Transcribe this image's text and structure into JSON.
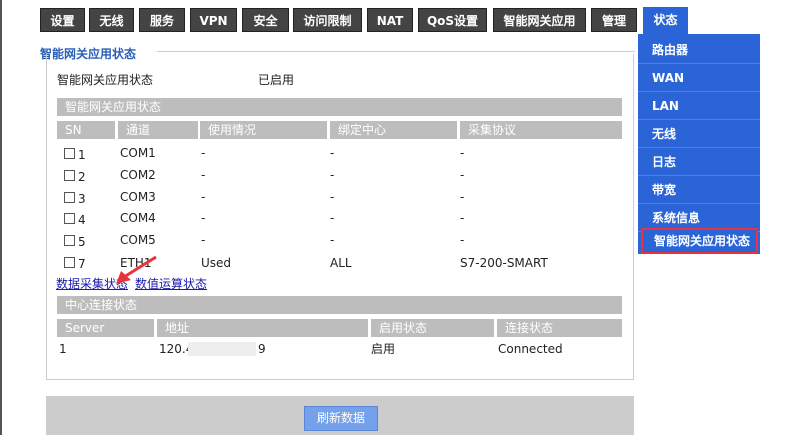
{
  "nav": {
    "tabs": [
      {
        "label": "设置"
      },
      {
        "label": "无线"
      },
      {
        "label": "服务"
      },
      {
        "label": "VPN"
      },
      {
        "label": "安全"
      },
      {
        "label": "访问限制"
      },
      {
        "label": "NAT"
      },
      {
        "label": "QoS设置"
      },
      {
        "label": "智能网关应用"
      },
      {
        "label": "管理"
      },
      {
        "label": "状态"
      }
    ],
    "active_tab": "状态"
  },
  "page": {
    "section_title": "智能网关应用状态",
    "status_label": "智能网关应用状态",
    "status_value": "已启用",
    "table_title": "智能网关应用状态",
    "columns": [
      "SN",
      "通道",
      "使用情况",
      "绑定中心",
      "采集协议"
    ],
    "rows": [
      {
        "sn": "1",
        "channel": "COM1",
        "usage": "-",
        "center": "-",
        "protocol": "-",
        "checked": false
      },
      {
        "sn": "2",
        "channel": "COM2",
        "usage": "-",
        "center": "-",
        "protocol": "-",
        "checked": false
      },
      {
        "sn": "3",
        "channel": "COM3",
        "usage": "-",
        "center": "-",
        "protocol": "-",
        "checked": false
      },
      {
        "sn": "4",
        "channel": "COM4",
        "usage": "-",
        "center": "-",
        "protocol": "-",
        "checked": false
      },
      {
        "sn": "5",
        "channel": "COM5",
        "usage": "-",
        "center": "-",
        "protocol": "-",
        "checked": false
      },
      {
        "sn": "7",
        "channel": "ETH1",
        "usage": "Used",
        "center": "ALL",
        "protocol": "S7-200-SMART",
        "checked": false
      }
    ],
    "links": {
      "collect_status": "数据采集状态",
      "compute_status": "数值运算状态"
    },
    "center_title": "中心连接状态",
    "center_columns": [
      "Server",
      "地址",
      "启用状态",
      "连接状态"
    ],
    "center_rows": [
      {
        "server": "1",
        "address_start": "120.4",
        "address_end": "9",
        "enabled": "启用",
        "connection": "Connected"
      }
    ],
    "refresh_label": "刷新数据"
  },
  "sidebar": {
    "items": [
      {
        "label": "路由器"
      },
      {
        "label": "WAN"
      },
      {
        "label": "LAN"
      },
      {
        "label": "无线"
      },
      {
        "label": "日志"
      },
      {
        "label": "带宽"
      },
      {
        "label": "系统信息"
      },
      {
        "label": "智能网关应用状态"
      }
    ],
    "selected": "智能网关应用状态"
  },
  "colors": {
    "accent": "#2a64d6",
    "highlight_border": "#e8333c",
    "annotation_arrow": "#e8333c",
    "tab_bg": "#444444",
    "header_gray": "#bdbdbd",
    "link": "#1a1aaa"
  }
}
